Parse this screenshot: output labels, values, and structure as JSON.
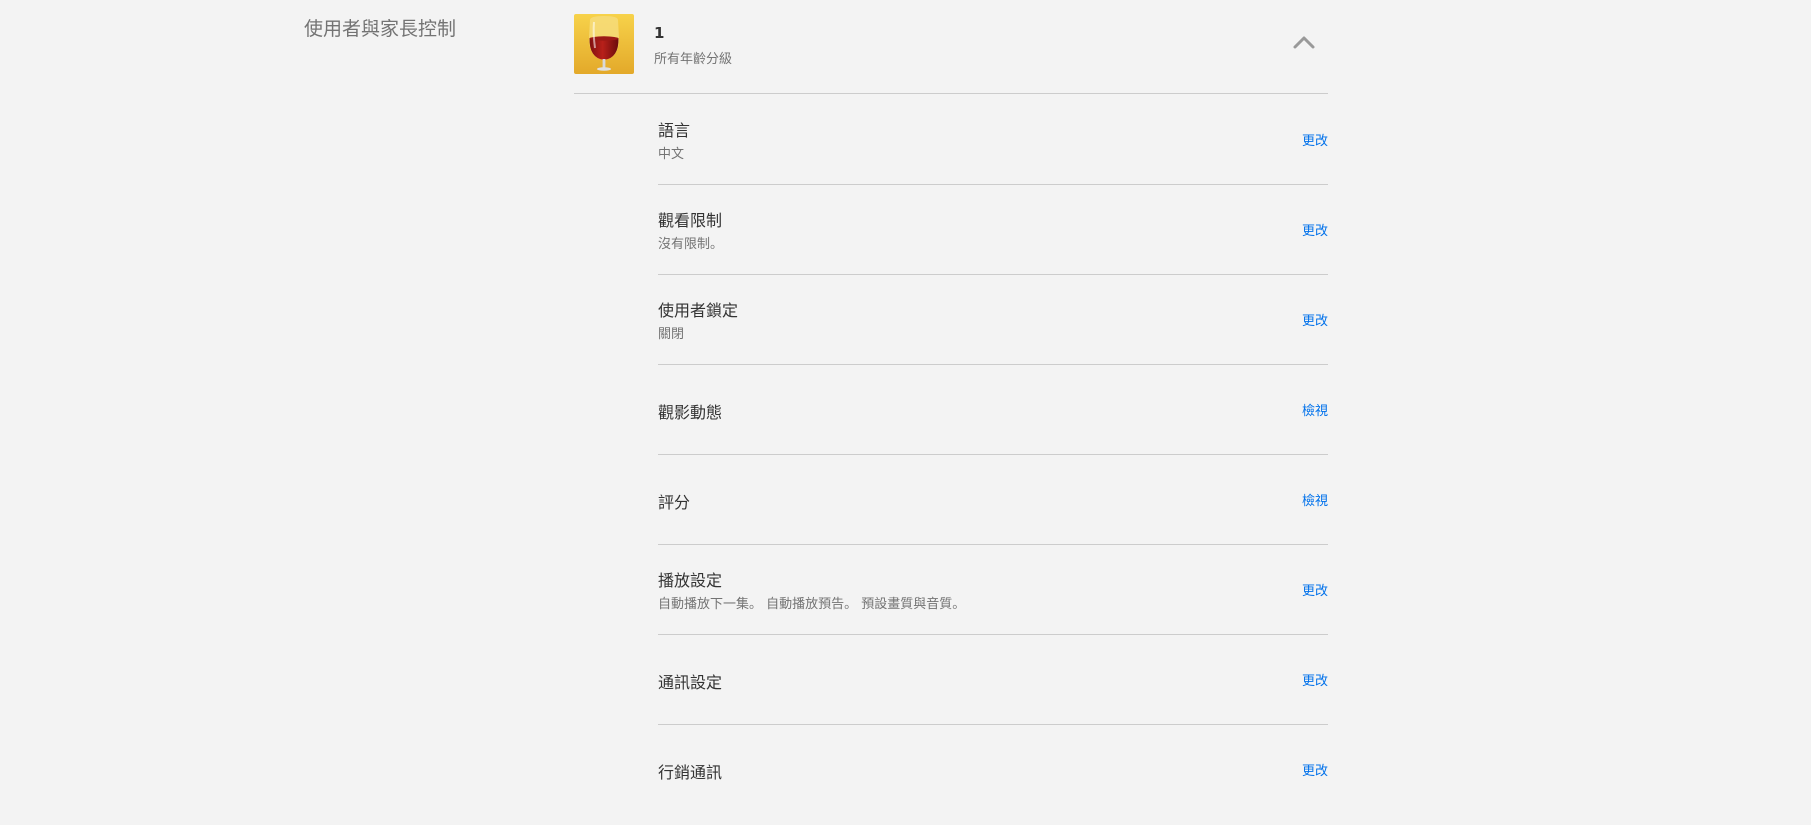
{
  "section": {
    "title": "使用者與家長控制"
  },
  "profile": {
    "name": "1",
    "rating": "所有年齡分級",
    "avatar_icon": "wine-glass-icon",
    "collapse_icon": "chevron-up-icon",
    "colors": {
      "avatar_bg": "#f0c23a",
      "accent_link": "#0071eb"
    }
  },
  "settings": [
    {
      "title": "語言",
      "subtitle": "中文",
      "action": "更改"
    },
    {
      "title": "觀看限制",
      "subtitle": "沒有限制。",
      "action": "更改"
    },
    {
      "title": "使用者鎖定",
      "subtitle": "關閉",
      "action": "更改"
    },
    {
      "title": "觀影動態",
      "subtitle": "",
      "action": "檢視"
    },
    {
      "title": "評分",
      "subtitle": "",
      "action": "檢視"
    },
    {
      "title": "播放設定",
      "subtitle": "自動播放下一集。 自動播放預告。 預設畫質與音質。",
      "action": "更改"
    },
    {
      "title": "通訊設定",
      "subtitle": "",
      "action": "更改"
    },
    {
      "title": "行銷通訊",
      "subtitle": "",
      "action": "更改"
    }
  ]
}
